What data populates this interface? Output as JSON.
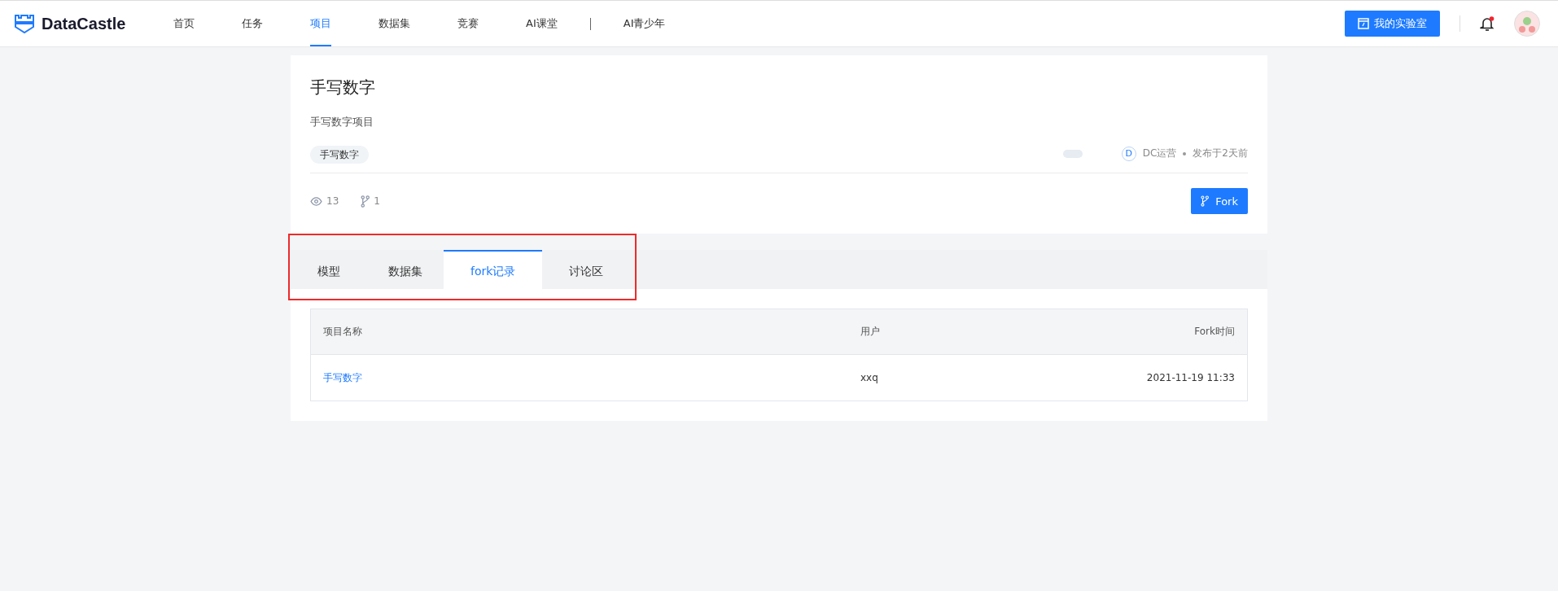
{
  "header": {
    "logo": "DataCastle",
    "nav": [
      {
        "kind": "link",
        "label": "首页",
        "selected": false
      },
      {
        "kind": "link",
        "label": "任务",
        "selected": false
      },
      {
        "kind": "link",
        "label": "项目",
        "selected": true
      },
      {
        "kind": "link",
        "label": "数据集",
        "selected": false
      },
      {
        "kind": "link",
        "label": "竞赛",
        "selected": false
      },
      {
        "kind": "link",
        "label": "AI课堂",
        "selected": false
      },
      {
        "kind": "separator"
      },
      {
        "kind": "link",
        "label": "AI青少年",
        "selected": false
      }
    ],
    "lab_button": "我的实验室",
    "has_unread": true
  },
  "project": {
    "title": "手写数字",
    "description": "手写数字项目",
    "tags": [
      "手写数字"
    ],
    "author_initial": "D",
    "author": "DC运营",
    "published": "发布于2天前",
    "views": "13",
    "forks": "1",
    "fork_button": "Fork"
  },
  "tabs_highlighted": true,
  "tabs": [
    {
      "label": "模型",
      "selected": false
    },
    {
      "label": "数据集",
      "selected": false
    },
    {
      "label": "fork记录",
      "selected": true
    },
    {
      "label": "讨论区",
      "selected": false
    }
  ],
  "table": {
    "columns": [
      "项目名称",
      "用户",
      "Fork时间"
    ],
    "rows": [
      [
        "手写数字",
        "xxq",
        "2021-11-19 11:33"
      ]
    ]
  }
}
